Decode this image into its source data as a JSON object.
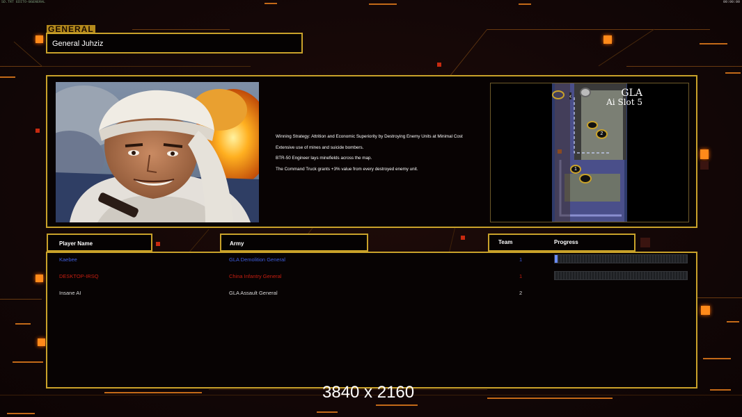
{
  "topbar": {
    "left_text": "SD.TRT EDITO-BGENERAL",
    "right_text": "00:00:00"
  },
  "general_tag": "GENERAL",
  "general_name": "General Juhziz",
  "strategy_lines": [
    "Winning Strategy: Attrition and Economic Superiority by Destroying Enemy Units at Minimal Cost",
    "Extensive use of mines and suicide bombers.",
    "BTR-50 Engineer lays minefields across the map.",
    "The Command Truck grants +3% value from every destroyed enemy unit."
  ],
  "minimap": {
    "title": "GLA",
    "subtitle": "Ai Slot 5",
    "markers": [
      "1",
      "2"
    ]
  },
  "columns": {
    "player": "Player Name",
    "army": "Army",
    "team": "Team",
    "progress": "Progress"
  },
  "players": [
    {
      "name": "Kaebee",
      "army": "GLA Demolition General",
      "team": "1",
      "color": "#3f5fe0",
      "progress": 0.02,
      "show_bar": true
    },
    {
      "name": "DESKTOP-IRSQ",
      "army": "China Infantry General",
      "team": "1",
      "color": "#c81e10",
      "progress": 0,
      "show_bar": true
    },
    {
      "name": "Insane AI",
      "army": "GLA Assault General",
      "team": "2",
      "color": "#d8d8d8",
      "progress": 0,
      "show_bar": false
    }
  ],
  "resolution_label": "3840 x 2160",
  "colors": {
    "gold_border": "#c9a22a",
    "accent_orange": "#ff8a1a",
    "background": "#120606"
  }
}
